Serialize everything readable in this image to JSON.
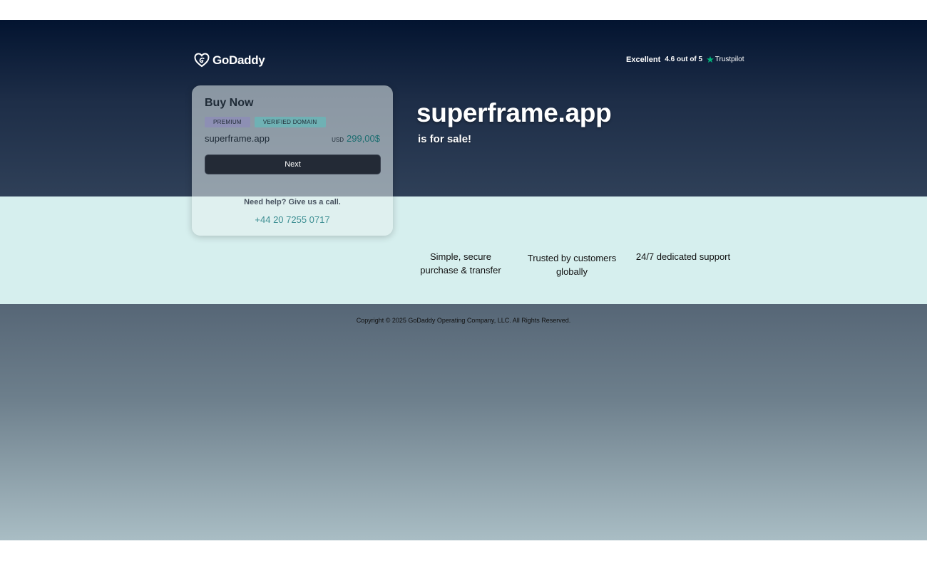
{
  "header": {
    "brand": "GoDaddy",
    "trustpilot": {
      "rating_word": "Excellent",
      "score_text": "4.6 out of 5",
      "provider": "Trustpilot"
    }
  },
  "buy_card": {
    "title": "Buy Now",
    "badges": [
      "PREMIUM",
      "VERIFIED DOMAIN"
    ],
    "domain": "superframe.app",
    "currency": "USD",
    "price": "299,00$",
    "next_label": "Next",
    "help_text": "Need help? Give us a call.",
    "phone": "+44 20 7255 0717"
  },
  "hero": {
    "domain": "superframe.app",
    "subtitle": "is for sale!"
  },
  "features": [
    "Simple, secure purchase & transfer",
    "Trusted by customers globally",
    "24/7 dedicated support"
  ],
  "footer": {
    "copyright": "Copyright © 2025 GoDaddy Operating Company, LLC. All Rights Reserved."
  },
  "colors": {
    "hero_top": "#031430",
    "band": "#d6efee",
    "accent_teal": "#3c8e92",
    "trustpilot_star": "#00b67a",
    "button_dark": "#232a36"
  },
  "icons": {
    "logo": "godaddy-heart-logo-icon",
    "star": "trustpilot-star-icon"
  }
}
